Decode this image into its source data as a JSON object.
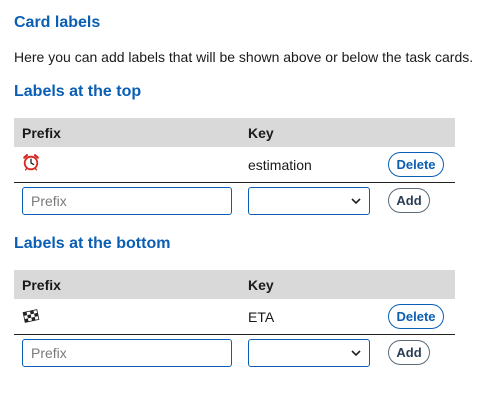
{
  "card_labels": {
    "title": "Card labels",
    "description": "Here you can add labels that will be shown above or below the task cards."
  },
  "top": {
    "title": "Labels at the top",
    "col_prefix": "Prefix",
    "col_key": "Key",
    "rows": [
      {
        "prefix_icon": "alarm-clock-icon",
        "key": "estimation",
        "delete_label": "Delete"
      }
    ],
    "new_prefix_placeholder": "Prefix",
    "new_key_value": "",
    "add_label": "Add"
  },
  "bottom": {
    "title": "Labels at the bottom",
    "col_prefix": "Prefix",
    "col_key": "Key",
    "rows": [
      {
        "prefix_icon": "checkered-flag-icon",
        "key": "ETA",
        "delete_label": "Delete"
      }
    ],
    "new_prefix_placeholder": "Prefix",
    "new_key_value": "",
    "add_label": "Add"
  },
  "colors": {
    "heading": "#0a5fb4",
    "table_header_bg": "#d9d9d9",
    "button_border": "#0a5fb4"
  }
}
